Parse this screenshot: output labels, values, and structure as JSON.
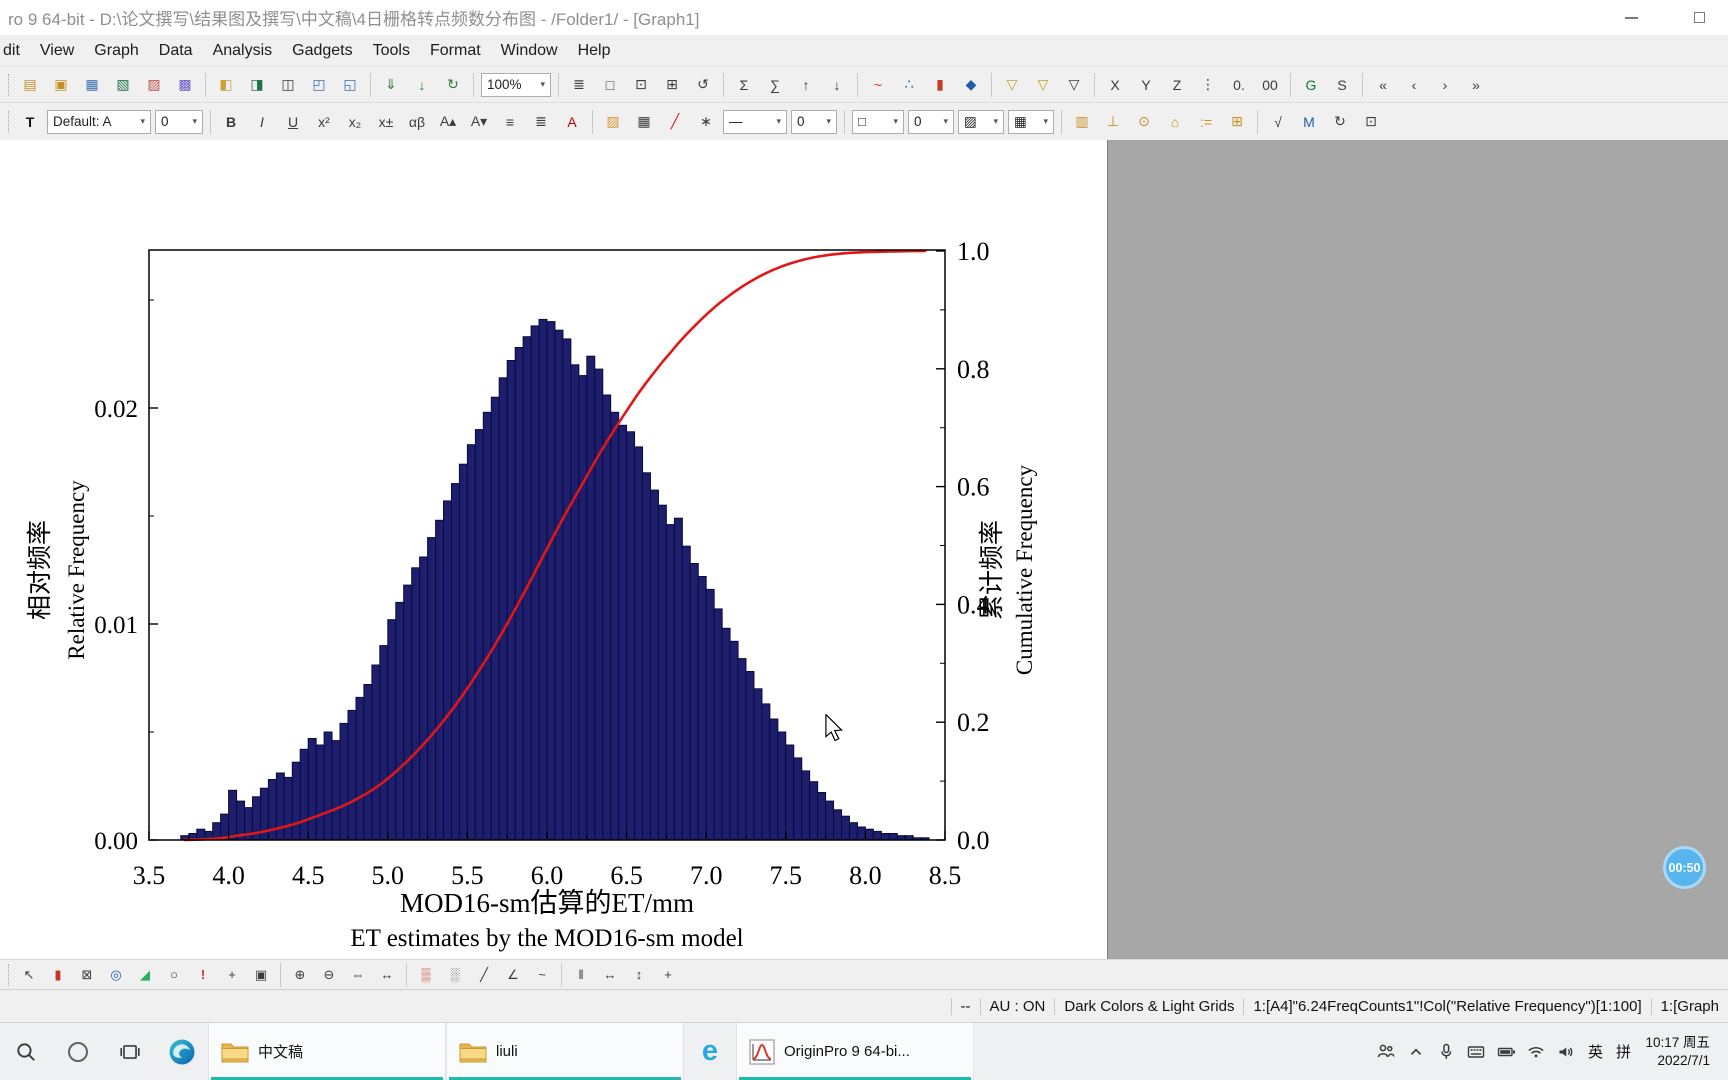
{
  "window": {
    "title": "ro 9 64-bit - D:\\论文撰写\\结果图及撰写\\中文稿\\4日栅格转点频数分布图 - /Folder1/ - [Graph1]"
  },
  "menu": {
    "items": [
      {
        "name": "menu-edit",
        "label": "dit"
      },
      {
        "name": "menu-view",
        "label": "View"
      },
      {
        "name": "menu-graph",
        "label": "Graph"
      },
      {
        "name": "menu-data",
        "label": "Data"
      },
      {
        "name": "menu-analysis",
        "label": "Analysis"
      },
      {
        "name": "menu-gadgets",
        "label": "Gadgets"
      },
      {
        "name": "menu-tools",
        "label": "Tools"
      },
      {
        "name": "menu-format",
        "label": "Format"
      },
      {
        "name": "menu-window",
        "label": "Window"
      },
      {
        "name": "menu-help",
        "label": "Help"
      }
    ]
  },
  "toolbar1": {
    "zoom_value": "100%",
    "group_new": [
      {
        "name": "new-project-button",
        "glyph": "▤",
        "css": "color:#c59022"
      },
      {
        "name": "new-folder-button",
        "glyph": "▣",
        "css": "color:#c59022"
      },
      {
        "name": "new-workbook-button",
        "glyph": "▦",
        "css": "color:#3b6fb3"
      },
      {
        "name": "new-excel-button",
        "glyph": "▧",
        "css": "color:#217346"
      },
      {
        "name": "new-graph-button",
        "glyph": "▨",
        "css": "color:#c0504d"
      },
      {
        "name": "new-matrix-button",
        "glyph": "▩",
        "css": "color:#6a5acd"
      }
    ],
    "group_file": [
      {
        "name": "open-button",
        "glyph": "◧",
        "css": "color:#caa23c"
      },
      {
        "name": "open-excel-button",
        "glyph": "◨",
        "css": "color:#217346"
      },
      {
        "name": "open-template-button",
        "glyph": "◫"
      },
      {
        "name": "save-project-button",
        "glyph": "◰",
        "css": "color:#3b6fb3"
      },
      {
        "name": "save-template-button",
        "glyph": "◱",
        "css": "color:#3b6fb3"
      }
    ],
    "group_import": [
      {
        "name": "import-wizard-button",
        "glyph": "⇓",
        "css": "color:#2e7d32"
      },
      {
        "name": "import-ascii-button",
        "glyph": "↓",
        "css": "color:#2e7d32"
      },
      {
        "name": "recalculate-button",
        "glyph": "↻",
        "css": "color:#2e7d32"
      }
    ],
    "group_print": [
      {
        "name": "print-button",
        "glyph": "≣"
      },
      {
        "name": "print-preview-button",
        "glyph": "□"
      },
      {
        "name": "copy-graph-button",
        "glyph": "⊡"
      },
      {
        "name": "new-layout-button",
        "glyph": "⊞"
      },
      {
        "name": "refresh-button",
        "glyph": "↺"
      }
    ],
    "group_stats": [
      {
        "name": "stats-on-columns-button",
        "glyph": "Σ"
      },
      {
        "name": "stats-on-rows-button",
        "glyph": "∑"
      },
      {
        "name": "sort-ascending-button",
        "glyph": "↑"
      },
      {
        "name": "sort-descending-button",
        "glyph": "↓"
      }
    ],
    "group_plot": [
      {
        "name": "plot-line-button",
        "glyph": "~",
        "css": "color:#c23b22"
      },
      {
        "name": "plot-scatter-button",
        "glyph": "∴",
        "css": "color:#1f5fa9"
      },
      {
        "name": "plot-column-button",
        "glyph": "▮",
        "css": "color:#c23b22"
      },
      {
        "name": "plot-template-button",
        "glyph": "◆",
        "css": "color:#1f5fa9"
      }
    ],
    "group_filter": [
      {
        "name": "data-filter-button",
        "glyph": "▽",
        "css": "color:#c9a227"
      },
      {
        "name": "lock-filter-button",
        "glyph": "▽",
        "css": "color:#c9a227"
      },
      {
        "name": "clear-filter-button",
        "glyph": "▽"
      }
    ],
    "group_columns": [
      {
        "name": "set-as-x-button",
        "glyph": "X"
      },
      {
        "name": "set-as-y-button",
        "glyph": "Y"
      },
      {
        "name": "set-as-z-button",
        "glyph": "Z"
      },
      {
        "name": "column-options-button",
        "glyph": "⋮"
      },
      {
        "name": "digits-increase-button",
        "glyph": "0."
      },
      {
        "name": "digits-decrease-button",
        "glyph": "00"
      }
    ],
    "group_letters": [
      {
        "name": "graph-mode-button",
        "glyph": "G",
        "css": "color:#0a7d30"
      },
      {
        "name": "script-mode-button",
        "glyph": "S"
      }
    ],
    "group_nav": [
      {
        "name": "first-window-button",
        "glyph": "«"
      },
      {
        "name": "previous-window-button",
        "glyph": "‹"
      },
      {
        "name": "next-window-button",
        "glyph": "›"
      },
      {
        "name": "last-window-button",
        "glyph": "»"
      }
    ]
  },
  "toolbar2": {
    "style_value": "Default: A",
    "size_value": "0",
    "line_style_value": "—",
    "line_width_value": "0",
    "border_value": "□",
    "border_width_value": "0",
    "hatch_value": "▨",
    "grid_value": "▦",
    "group_text": [
      {
        "name": "text-tool-button",
        "glyph": "T",
        "css": "font-weight:700;color:#111"
      }
    ],
    "group_font": [
      {
        "name": "bold-button",
        "glyph": "B",
        "css": "font-weight:700"
      },
      {
        "name": "italic-button",
        "glyph": "I",
        "css": "font-style:italic"
      },
      {
        "name": "underline-button",
        "glyph": "U",
        "css": "text-decoration:underline"
      },
      {
        "name": "superscript-button",
        "glyph": "x²"
      },
      {
        "name": "subscript-button",
        "glyph": "x₂"
      },
      {
        "name": "super-subscript-button",
        "glyph": "x±"
      },
      {
        "name": "greek-button",
        "glyph": "αβ"
      },
      {
        "name": "increase-font-button",
        "glyph": "A▴"
      },
      {
        "name": "decrease-font-button",
        "glyph": "A▾"
      },
      {
        "name": "align-left-button",
        "glyph": "≡"
      },
      {
        "name": "align-center-button",
        "glyph": "≣"
      },
      {
        "name": "font-color-button",
        "glyph": "A",
        "css": "color:#c00000"
      }
    ],
    "group_fill": [
      {
        "name": "fill-color-button",
        "glyph": "▨",
        "css": "color:#d79b2f"
      },
      {
        "name": "pattern-button",
        "glyph": "▦"
      },
      {
        "name": "line-color-button",
        "glyph": "╱",
        "css": "color:#cc2222"
      },
      {
        "name": "effects-button",
        "glyph": "∗"
      }
    ],
    "group_object": [
      {
        "name": "add-color-scale-button",
        "glyph": "▥",
        "css": "color:#c59022"
      },
      {
        "name": "add-axis-scale-button",
        "glyph": "⊥",
        "css": "color:#c59022"
      },
      {
        "name": "date-stamp-button",
        "glyph": "⊙",
        "css": "color:#c59022"
      },
      {
        "name": "project-path-button",
        "glyph": "⌂",
        "css": "color:#c59022"
      },
      {
        "name": "legend-button",
        "glyph": ":=",
        "css": "color:#c59022"
      },
      {
        "name": "add-table-button",
        "glyph": "⊞",
        "css": "color:#c59022"
      }
    ],
    "group_insert": [
      {
        "name": "insert-equation-button",
        "glyph": "√"
      },
      {
        "name": "insert-object-button",
        "glyph": "M",
        "css": "color:#1f5fa9"
      },
      {
        "name": "update-objects-button",
        "glyph": "↻"
      },
      {
        "name": "insert-graph-button",
        "glyph": "⊡"
      }
    ]
  },
  "tools_toolbar": {
    "group_pointer": [
      {
        "name": "pointer-tool-button",
        "glyph": "↖"
      },
      {
        "name": "column-gadget-button",
        "glyph": "▮",
        "css": "color:#c0392b"
      },
      {
        "name": "region-select-button",
        "glyph": "⊠"
      },
      {
        "name": "screen-reader-button",
        "glyph": "◎",
        "css": "color:#1f5fa9"
      },
      {
        "name": "area-gadget-button",
        "glyph": "◢",
        "css": "color:#27ae60"
      },
      {
        "name": "circle-tool-button",
        "glyph": "○"
      },
      {
        "name": "annotation-button",
        "glyph": "!",
        "css": "color:#c0392b;font-weight:700"
      },
      {
        "name": "color-picker-button",
        "glyph": "+"
      },
      {
        "name": "layer-manager-button",
        "glyph": "▣"
      }
    ],
    "group_zoom": [
      {
        "name": "zoom-in-tool-button",
        "glyph": "⊕"
      },
      {
        "name": "zoom-out-tool-button",
        "glyph": "⊖"
      },
      {
        "name": "pan-tool-button",
        "glyph": "⇔"
      },
      {
        "name": "rescale-tool-button",
        "glyph": "↔"
      }
    ],
    "group_mask": [
      {
        "name": "mask-points-button",
        "glyph": "▒",
        "css": "color:#c0392b"
      },
      {
        "name": "unmask-points-button",
        "glyph": "░"
      },
      {
        "name": "draw-line-button",
        "glyph": "╱"
      },
      {
        "name": "draw-polyline-button",
        "glyph": "∠"
      },
      {
        "name": "freehand-draw-button",
        "glyph": "~"
      }
    ],
    "group_scale": [
      {
        "name": "vertical-cursor-button",
        "glyph": "‖"
      },
      {
        "name": "x-distance-button",
        "glyph": "↔"
      },
      {
        "name": "y-distance-button",
        "glyph": "↕"
      },
      {
        "name": "xy-distance-button",
        "glyph": "+"
      }
    ]
  },
  "statusbar": {
    "panes": [
      "--",
      "AU : ON",
      "Dark Colors & Light Grids",
      "1:[A4]\"6.24FreqCounts1\"!Col(\"Relative Frequency\")[1:100]",
      "1:[Graph"
    ]
  },
  "taskbar": {
    "folder1_label": "中文稿",
    "folder2_label": "liuli",
    "origin_label": "OriginPro 9 64-bi...",
    "lang": "英",
    "ime": "拼",
    "time": "10:17 周五",
    "date": "2022/7/1"
  },
  "recorder": {
    "time": "00:50"
  },
  "chart_data": {
    "type": "histogram+cumulative",
    "title": "",
    "x_axis": {
      "title_zh": "MOD16-sm估算的ET/mm",
      "title_en": "ET estimates by the MOD16-sm model",
      "min": 3.5,
      "max": 8.5,
      "ticks": [
        3.5,
        4.0,
        4.5,
        5.0,
        5.5,
        6.0,
        6.5,
        7.0,
        7.5,
        8.0,
        8.5
      ],
      "tick_labels": [
        "3.5",
        "4.0",
        "4.5",
        "5.0",
        "5.5",
        "6.0",
        "6.5",
        "7.0",
        "7.5",
        "8.0",
        "8.5"
      ]
    },
    "y_left": {
      "title_zh": "相对频率",
      "title_en": "Relative Frequency",
      "lim": [
        0,
        0.0273
      ],
      "ticks": [
        0,
        0.01,
        0.02
      ],
      "tick_labels": [
        "0.00",
        "0.01",
        "0.02"
      ]
    },
    "y_right": {
      "title_zh": "累计频率",
      "title_en": "Cumulative Frequency",
      "lim": [
        0,
        1.0
      ],
      "ticks": [
        0,
        0.2,
        0.4,
        0.6,
        0.8,
        1.0
      ],
      "tick_labels": [
        "0.0",
        "0.2",
        "0.4",
        "0.6",
        "0.8",
        "1.0"
      ]
    },
    "bars": {
      "color": "#1e1e6e",
      "edge_color": "#0a0a38",
      "bin_start": 3.7,
      "bin_width": 0.05,
      "values": [
        0.0002,
        0.0003,
        0.0005,
        0.0004,
        0.0008,
        0.0012,
        0.0023,
        0.0018,
        0.0015,
        0.002,
        0.0024,
        0.0028,
        0.0031,
        0.0029,
        0.0036,
        0.0042,
        0.0047,
        0.0044,
        0.005,
        0.0046,
        0.0054,
        0.006,
        0.0066,
        0.0072,
        0.0081,
        0.009,
        0.0102,
        0.011,
        0.0118,
        0.0126,
        0.0131,
        0.014,
        0.0148,
        0.0157,
        0.0165,
        0.0174,
        0.0183,
        0.019,
        0.0198,
        0.0205,
        0.0214,
        0.0222,
        0.0228,
        0.0233,
        0.0238,
        0.0241,
        0.024,
        0.0236,
        0.0232,
        0.022,
        0.0215,
        0.0224,
        0.0218,
        0.0206,
        0.0198,
        0.0192,
        0.0189,
        0.0182,
        0.017,
        0.0162,
        0.0155,
        0.0146,
        0.0149,
        0.0136,
        0.0128,
        0.0122,
        0.0116,
        0.0107,
        0.0098,
        0.0092,
        0.0084,
        0.0078,
        0.007,
        0.0063,
        0.0056,
        0.005,
        0.0044,
        0.0038,
        0.0032,
        0.0027,
        0.0022,
        0.0018,
        0.0014,
        0.0011,
        0.0008,
        0.0006,
        0.0005,
        0.0004,
        0.0003,
        0.0003,
        0.0002,
        0.0002,
        0.0001,
        0.0001
      ]
    },
    "cumulative": {
      "color": "#e01717",
      "line_width": 2.6,
      "note": "normalized cumulative of bar values, right axis"
    }
  }
}
